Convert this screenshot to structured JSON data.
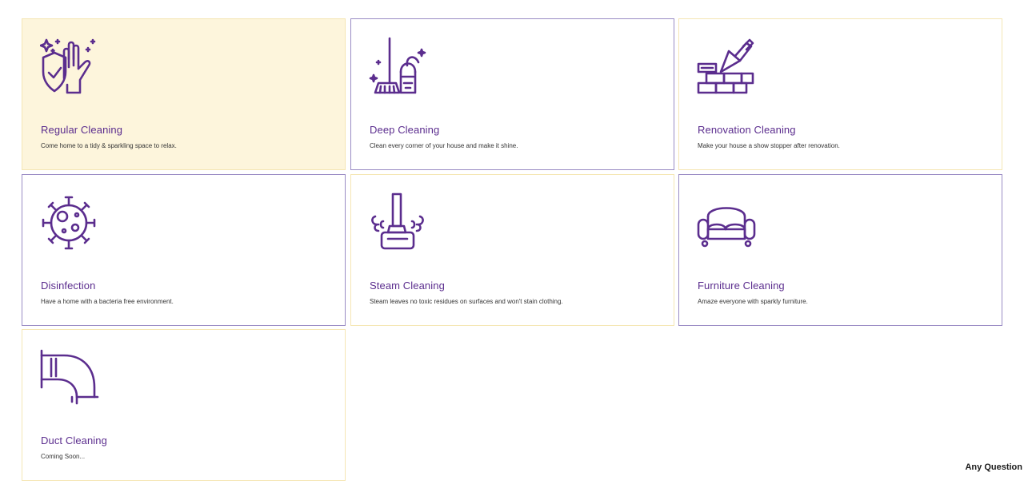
{
  "services": [
    {
      "title": "Regular Cleaning",
      "description": "Come home to a tidy & sparkling space to relax.",
      "icon": "shield-hand-icon"
    },
    {
      "title": "Deep Cleaning",
      "description": "Clean every corner of your house and make it shine.",
      "icon": "broom-bucket-icon"
    },
    {
      "title": "Renovation Cleaning",
      "description": "Make your house a show stopper after renovation.",
      "icon": "bricks-trowel-icon"
    },
    {
      "title": "Disinfection",
      "description": "Have a home with a bacteria free environment.",
      "icon": "virus-icon"
    },
    {
      "title": "Steam Cleaning",
      "description": "Steam leaves no toxic residues on surfaces and won't stain clothing.",
      "icon": "steam-mop-icon"
    },
    {
      "title": "Furniture Cleaning",
      "description": "Amaze everyone with sparkly furniture.",
      "icon": "sofa-icon"
    },
    {
      "title": "Duct Cleaning",
      "description": "Coming Soon...",
      "icon": "duct-pipe-icon"
    }
  ],
  "any_question_label": "Any Question",
  "colors": {
    "accent": "#5b2d8e",
    "active_card_bg": "#fdf5dc",
    "card_border_yellow": "#f5e6b3",
    "card_border_purple": "#9a8cc4"
  }
}
